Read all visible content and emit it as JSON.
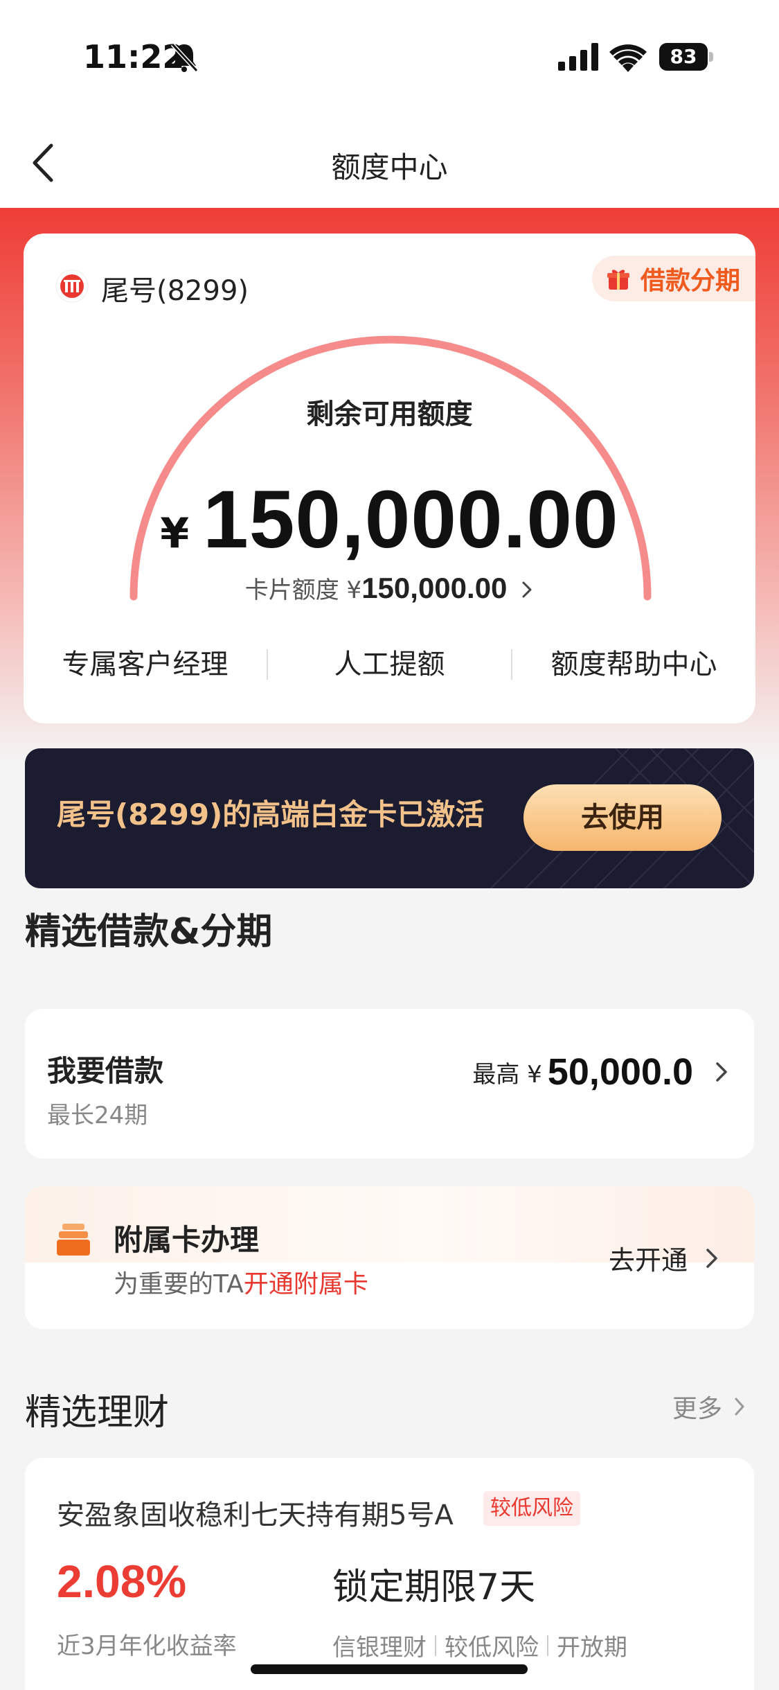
{
  "status_bar": {
    "time": "11:22",
    "battery": "83"
  },
  "nav": {
    "title": "额度中心"
  },
  "quota_card": {
    "card_tail": "尾号(8299)",
    "loan_tag": "借款分期",
    "remaining_label": "剩余可用额度",
    "currency": "¥",
    "remaining_amount": "150,000.00",
    "card_limit_label": "卡片额度 ¥",
    "card_limit_value": "150,000.00",
    "links": [
      "专属客户经理",
      "人工提额",
      "额度帮助中心"
    ]
  },
  "banner": {
    "text": "尾号(8299)的高端白金卡已激活",
    "button": "去使用"
  },
  "loan_section": {
    "title": "精选借款&分期",
    "loan": {
      "title": "我要借款",
      "subtitle": "最长24期",
      "prefix": "最高 ¥",
      "max": "50,000.0"
    },
    "sub_card": {
      "title": "附属卡办理",
      "desc_prefix": "为重要的TA",
      "desc_highlight": "开通附属卡",
      "action": "去开通"
    }
  },
  "wealth_section": {
    "title": "精选理财",
    "more": "更多",
    "fund": {
      "name": "安盈象固收稳利七天持有期5号A",
      "risk_tag": "较低风险",
      "rate": "2.08%",
      "rate_label": "近3月年化收益率",
      "lock": "锁定期限7天",
      "tags": [
        "信银理财",
        "较低风险",
        "开放期"
      ]
    }
  },
  "colors": {
    "accent_red": "#ec3d34",
    "banner_gold": "#f3c28a",
    "orange": "#ef5a1e"
  }
}
